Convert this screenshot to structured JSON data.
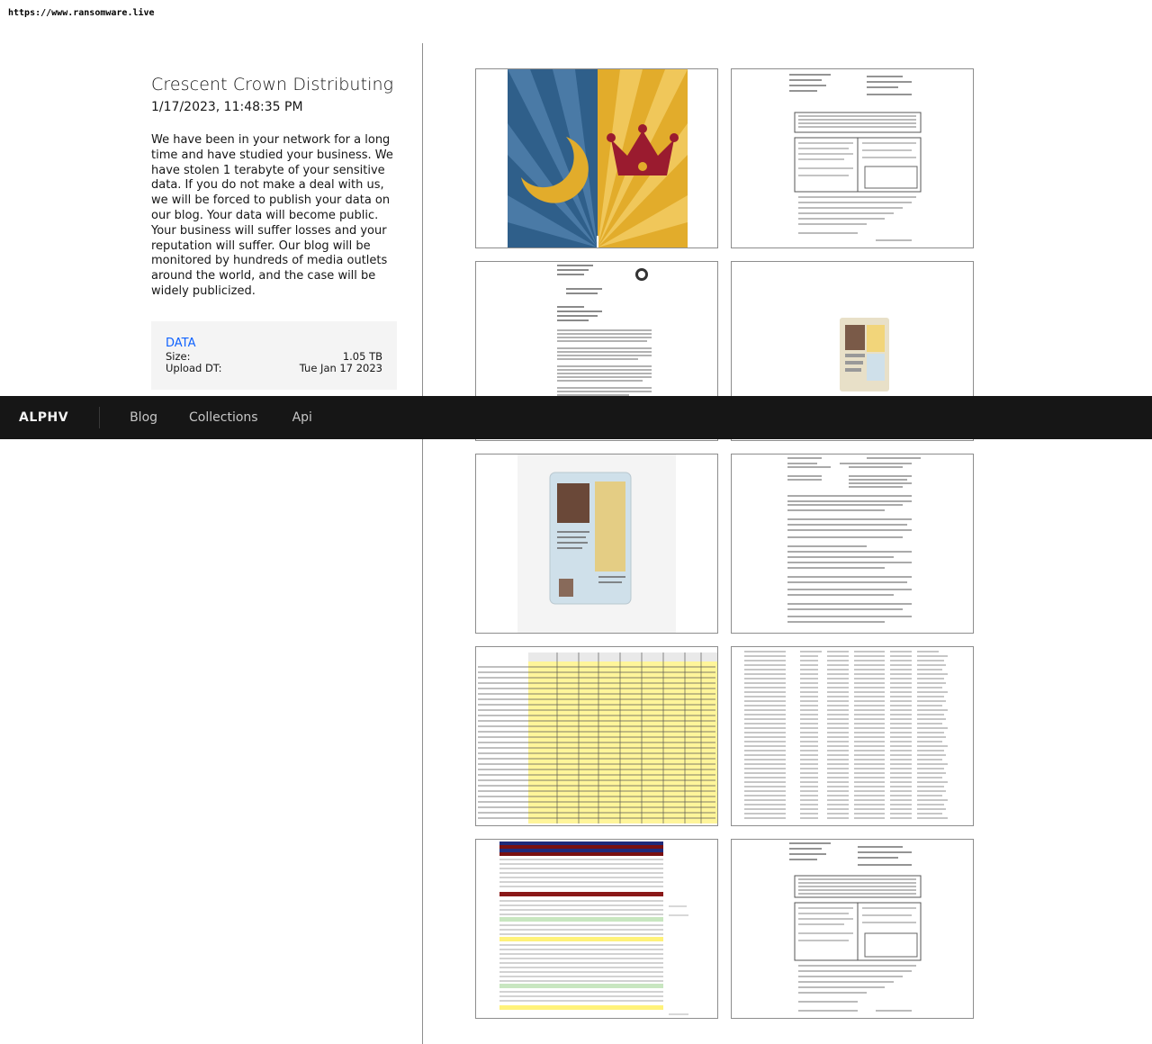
{
  "url": "https://www.ransomware.live",
  "post": {
    "title": "Crescent Crown Distributing",
    "date": "1/17/2023, 11:48:35 PM",
    "description": "We have been in your network for a long time and have studied your business. We have stolen 1 terabyte of your sensitive data. If you do not make a deal with us, we will be forced to publish your data on our blog. Your data will become public. Your business will suffer losses and your reputation will suffer. Our blog will be monitored by hundreds of media outlets around the world, and the case will be widely publicized.",
    "data": {
      "link_label": "DATA",
      "size_label": "Size:",
      "size_value": "1.05 TB",
      "upload_label": "Upload DT:",
      "upload_value": "Tue Jan 17 2023"
    }
  },
  "nav": {
    "brand": "ALPHV",
    "links": [
      "Blog",
      "Collections",
      "Api"
    ]
  },
  "gallery": {
    "thumbnails": [
      "company-logo",
      "withholding-form",
      "treasury-letter",
      "id-card-scan",
      "driver-license",
      "driver-record",
      "financial-spreadsheet",
      "employee-roster",
      "staff-phone-list",
      "withholding-form-2"
    ]
  },
  "colors": {
    "nav_bg": "#161616",
    "link": "#0f62fe",
    "logo_blue": "#2f5f8a",
    "logo_gold": "#e2ac2b",
    "logo_crown": "#9a1b2f"
  }
}
